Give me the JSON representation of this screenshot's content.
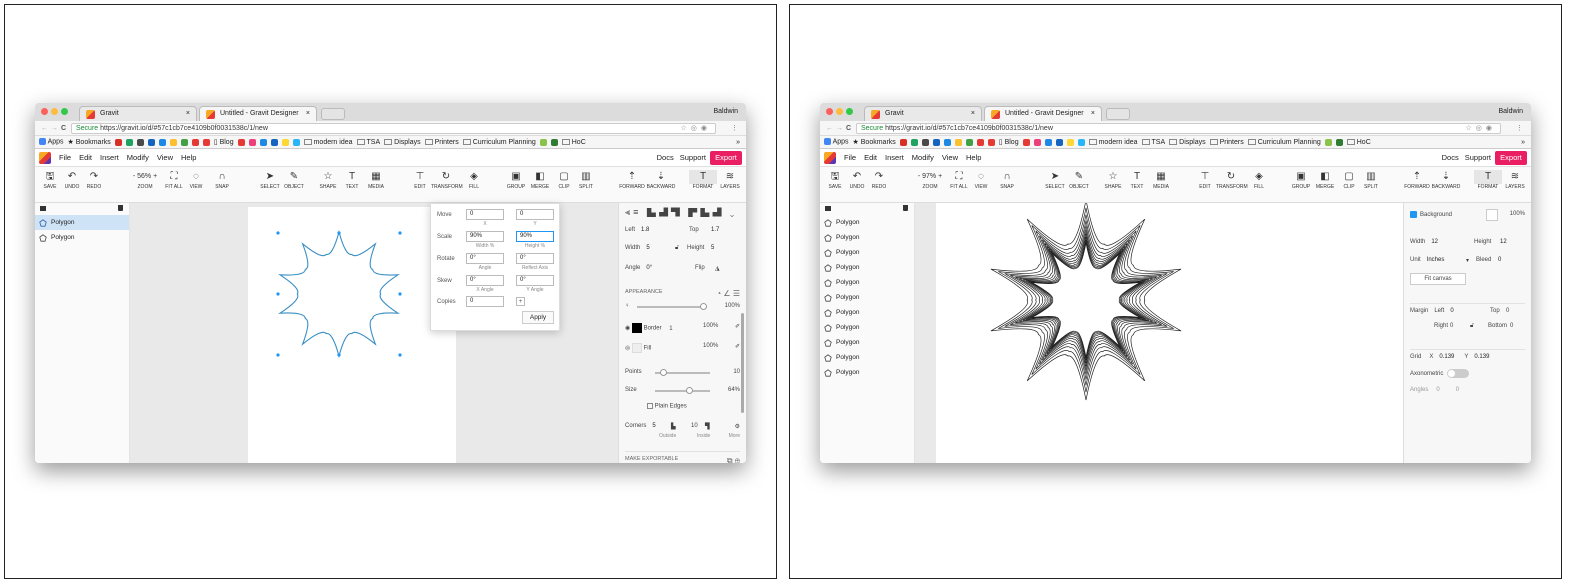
{
  "browser": {
    "tab1": "Gravit",
    "tab2": "Untitled - Gravit Designer",
    "tab_close": "×",
    "user": "Baldwin",
    "secure": "Secure",
    "url": "https://gravit.io/d/#57c1cb7ce4109b0f0031538c/1/new",
    "bookmarks": [
      "Apps",
      "Bookmarks",
      "Blog",
      "modern idea",
      "TSA",
      "Displays",
      "Printers",
      "Curriculum Planning",
      "HoC"
    ],
    "bookmark_overflow": "»"
  },
  "app": {
    "menu": [
      "File",
      "Edit",
      "Insert",
      "Modify",
      "View",
      "Help"
    ],
    "docs": "Docs",
    "support": "Support",
    "export": "Export",
    "toolbar": {
      "save": "SAVE",
      "undo": "UNDO",
      "redo": "REDO",
      "zoom": "ZOOM",
      "fitall": "FIT ALL",
      "view": "VIEW",
      "snap": "SNAP",
      "select": "SELECT",
      "object": "OBJECT",
      "shape": "SHAPE",
      "text": "TEXT",
      "media": "MEDIA",
      "edit": "EDIT",
      "transform": "TRANSFORM",
      "fill": "FILL",
      "group": "GROUP",
      "merge": "MERGE",
      "clip": "CLIP",
      "split": "SPLIT",
      "forward": "FORWARD",
      "backward": "BACKWARD",
      "format": "FORMAT",
      "layers": "LAYERS"
    },
    "layer_name": "Polygon"
  },
  "shot1": {
    "zoom": "56%",
    "layers": [
      "Polygon",
      "Polygon"
    ],
    "transform": {
      "move": "Move",
      "move_x": "0",
      "move_y": "0",
      "x": "X",
      "y": "Y",
      "scale": "Scale",
      "scale_w": "90%",
      "scale_h": "90%",
      "width_pct": "Width %",
      "height_pct": "Height %",
      "rotate": "Rotate",
      "rotate_v": "0°",
      "reflect_v": "0°",
      "angle": "Angle",
      "reflect_axis": "Reflect Axis",
      "skew": "Skew",
      "skew_x": "0°",
      "skew_y": "0°",
      "x_angle": "X Angle",
      "y_angle": "Y Angle",
      "copies": "Copies",
      "copies_v": "0",
      "apply": "Apply",
      "plus": "+"
    },
    "inspector": {
      "left": "Left",
      "left_v": "1.8",
      "top": "Top",
      "top_v": "1.7",
      "width": "Width",
      "width_v": "5",
      "height": "Height",
      "height_v": "5",
      "angle": "Angle",
      "angle_v": "0°",
      "flip": "Flip",
      "appearance": "APPEARANCE",
      "opacity": "100%",
      "opacity_level": 1.0,
      "border": "Border",
      "border_w": "1",
      "border_op": "100%",
      "fill": "Fill",
      "fill_op": "100%",
      "points": "Points",
      "points_v": "10",
      "points_level": 0.1,
      "size": "Size",
      "size_v": "64%",
      "size_level": 0.64,
      "plain_edges": "Plain Edges",
      "corners": "Corners",
      "outside_v": "5",
      "inside_v": "10",
      "outside": "Outside",
      "inside": "Inside",
      "more": "More",
      "make_exportable": "MAKE EXPORTABLE"
    },
    "colors": {
      "selection": "#2196f3",
      "border": "#000000"
    }
  },
  "shot2": {
    "zoom": "97%",
    "layers": [
      "Polygon",
      "Polygon",
      "Polygon",
      "Polygon",
      "Polygon",
      "Polygon",
      "Polygon",
      "Polygon",
      "Polygon",
      "Polygon",
      "Polygon"
    ],
    "inspector": {
      "background": "Background",
      "bg_op": "100%",
      "width": "Width",
      "width_v": "12",
      "height": "Height",
      "height_v": "12",
      "unit": "Unit",
      "unit_v": "Inches",
      "bleed": "Bleed",
      "bleed_v": "0",
      "fit_canvas": "Fit canvas",
      "margin": "Margin",
      "left": "Left",
      "left_v": "0",
      "top": "Top",
      "top_v": "0",
      "right": "Right",
      "right_v": "0",
      "bottom": "Bottom",
      "bottom_v": "0",
      "grid": "Grid",
      "x": "X",
      "x_v": "0.139",
      "y": "Y",
      "y_v": "0.139",
      "axonometric": "Axonometric",
      "angles": "Angles",
      "angles_v": "0",
      "angles_v2": "0"
    }
  }
}
